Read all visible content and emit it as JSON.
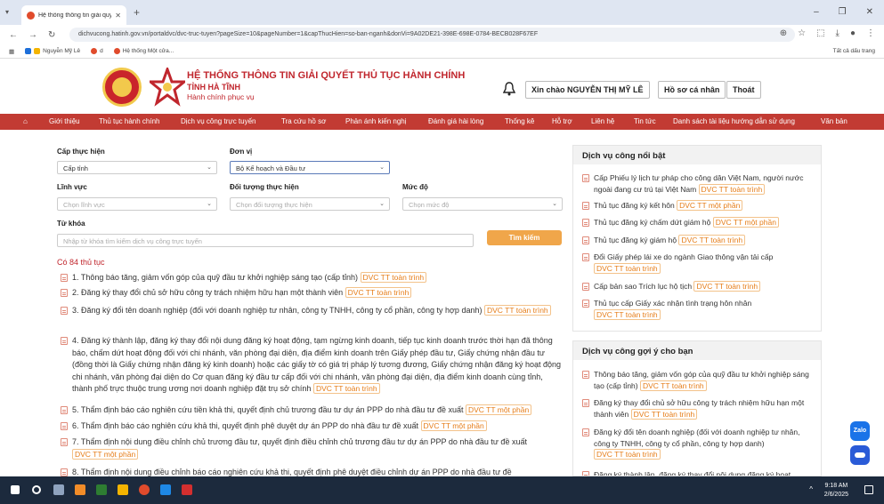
{
  "browser": {
    "tab_title": "Hệ thống thông tin giải quyết t",
    "url": "dichvucong.hatinh.gov.vn/portaldvc/dvc-truc-tuyen?pageSize=10&pageNumber=1&capThucHien=so-ban-nganh&donVi=9A02DE21-398E-698E-0784-BECB028F67EF",
    "bookmarks": [
      "Nguyễn Mỹ Lê",
      "d",
      "Hệ thống Một cửa..."
    ],
    "all_bookmarks": "Tất cả dấu trang"
  },
  "header": {
    "title_line1": "HỆ THỐNG THÔNG TIN GIẢI QUYẾT THỦ TỤC HÀNH CHÍNH",
    "title_line2": "TỈNH HÀ TĨNH",
    "title_line3": "Hành chính phục vụ",
    "greeting": "Xin chào NGUYỄN THỊ MỸ LÊ",
    "profile": "Hồ sơ cá nhân",
    "logout": "Thoát"
  },
  "nav": [
    "Giới thiệu",
    "Thủ tục hành chính",
    "Dịch vụ công trực tuyến",
    "Tra cứu hồ sơ",
    "Phản ánh kiến nghị",
    "Đánh giá hài lòng",
    "Thống kê",
    "Hỗ trợ",
    "Liên hệ",
    "Tin tức",
    "Danh sách tài liệu hướng dẫn sử dụng",
    "Văn bản"
  ],
  "filters": {
    "cap_label": "Cấp thực hiện",
    "cap_value": "Cấp tỉnh",
    "donvi_label": "Đơn vị",
    "donvi_value": "Bộ Kế hoạch và Đầu tư",
    "linhvuc_label": "Lĩnh vực",
    "linhvuc_ph": "Chọn lĩnh vực",
    "doituong_label": "Đối tượng thực hiện",
    "doituong_ph": "Chọn đối tượng thực hiện",
    "mucdo_label": "Mức độ",
    "mucdo_ph": "Chọn mức độ",
    "keyword_label": "Từ khóa",
    "keyword_ph": "Nhập từ khóa tìm kiếm dịch vụ công trực tuyến",
    "search_btn": "Tìm kiếm"
  },
  "result_count": "Có 84 thủ tục",
  "procedures": [
    {
      "text": "1. Thông báo tăng, giảm vốn góp của quỹ đầu tư khởi nghiệp sáng tạo (cấp tỉnh)",
      "badge": "DVC TT toàn trình"
    },
    {
      "text": "2. Đăng ký thay đổi chủ sở hữu công ty trách nhiệm hữu hạn một thành viên",
      "badge": "DVC TT toàn trình"
    },
    {
      "text": "3. Đăng ký đổi tên doanh nghiệp (đối với doanh nghiệp tư nhân, công ty TNHH, công ty cổ phần, công ty hợp danh)",
      "badge": "DVC TT toàn trình"
    },
    {
      "text": "4. Đăng ký thành lập, đăng ký thay đổi nội dung đăng ký hoạt động, tạm ngừng kinh doanh, tiếp tục kinh doanh trước thời hạn đã thông báo, chấm dứt hoạt động đối với chi nhánh, văn phòng đại diện, địa điểm kinh doanh trên Giấy phép đầu tư, Giấy chứng nhận đầu tư (đồng thời là Giấy chứng nhận đăng ký kinh doanh) hoặc các giấy tờ có giá trị pháp lý tương đương, Giấy chứng nhận đăng ký hoạt động chi nhánh, văn phòng đại diện do Cơ quan đăng ký đầu tư cấp đối với chi nhánh, văn phòng đại diện, địa điểm kinh doanh cùng tỉnh, thành phố trực thuộc trung ương nơi doanh nghiệp đặt trụ sở chính",
      "badge": "DVC TT toàn trình"
    },
    {
      "text": "5. Thẩm định báo cáo nghiên cứu tiền khả thi, quyết định chủ trương đầu tư dự án PPP do nhà đầu tư đề xuất",
      "badge": "DVC TT một phần"
    },
    {
      "text": "6. Thẩm định báo cáo nghiên cứu khả thi, quyết định phê duyệt dự án PPP do nhà đầu tư đề xuất",
      "badge": "DVC TT một phần"
    },
    {
      "text": "7. Thẩm định nội dung điều chỉnh chủ trương đầu tư, quyết định điều chỉnh chủ trương đầu tư dự án PPP do nhà đầu tư đề xuất",
      "badge": "DVC TT một phần"
    },
    {
      "text": "8. Thẩm định nội dung điều chỉnh báo cáo nghiên cứu khả thi, quyết định phê duyệt điều chỉnh dự án PPP do nhà đầu tư đề",
      "badge": ""
    }
  ],
  "featured": {
    "title": "Dịch vụ công nổi bật",
    "items": [
      {
        "text": "Cấp Phiếu lý lịch tư pháp cho công dân Việt Nam, người nước ngoài đang cư trú tại Việt Nam",
        "badge": "DVC TT toàn trình"
      },
      {
        "text": "Thủ tục đăng ký kết hôn",
        "badge": "DVC TT một phần"
      },
      {
        "text": "Thủ tục đăng ký chấm dứt giám hộ",
        "badge": "DVC TT một phần"
      },
      {
        "text": "Thủ tục đăng ký giám hộ",
        "badge": "DVC TT toàn trình"
      },
      {
        "text": "Đổi Giấy phép lái xe do ngành Giao thông vận tải cấp",
        "badge": "DVC TT toàn trình"
      },
      {
        "text": "Cấp bản sao Trích lục hộ tịch",
        "badge": "DVC TT toàn trình"
      },
      {
        "text": "Thủ tục cấp Giấy xác nhận tình trạng hôn nhân",
        "badge": "DVC TT toàn trình"
      }
    ]
  },
  "suggested": {
    "title": "Dịch vụ công gợi ý cho bạn",
    "items": [
      {
        "text": "Thông báo tăng, giảm vốn góp của quỹ đầu tư khởi nghiệp sáng tạo (cấp tỉnh)",
        "badge": "DVC TT toàn trình"
      },
      {
        "text": "Đăng ký thay đổi chủ sở hữu công ty trách nhiệm hữu hạn một thành viên",
        "badge": "DVC TT toàn trình"
      },
      {
        "text": "Đăng ký đổi tên doanh nghiệp (đối với doanh nghiệp tư nhân, công ty TNHH, công ty cổ phần, công ty hợp danh)",
        "badge": "DVC TT toàn trình"
      },
      {
        "text": "Đăng ký thành lập, đăng ký thay đổi nội dung đăng ký hoạt",
        "badge": ""
      }
    ]
  },
  "zalo_label": "Zalo",
  "taskbar": {
    "time": "9:18 AM",
    "date": "2/6/2025"
  }
}
